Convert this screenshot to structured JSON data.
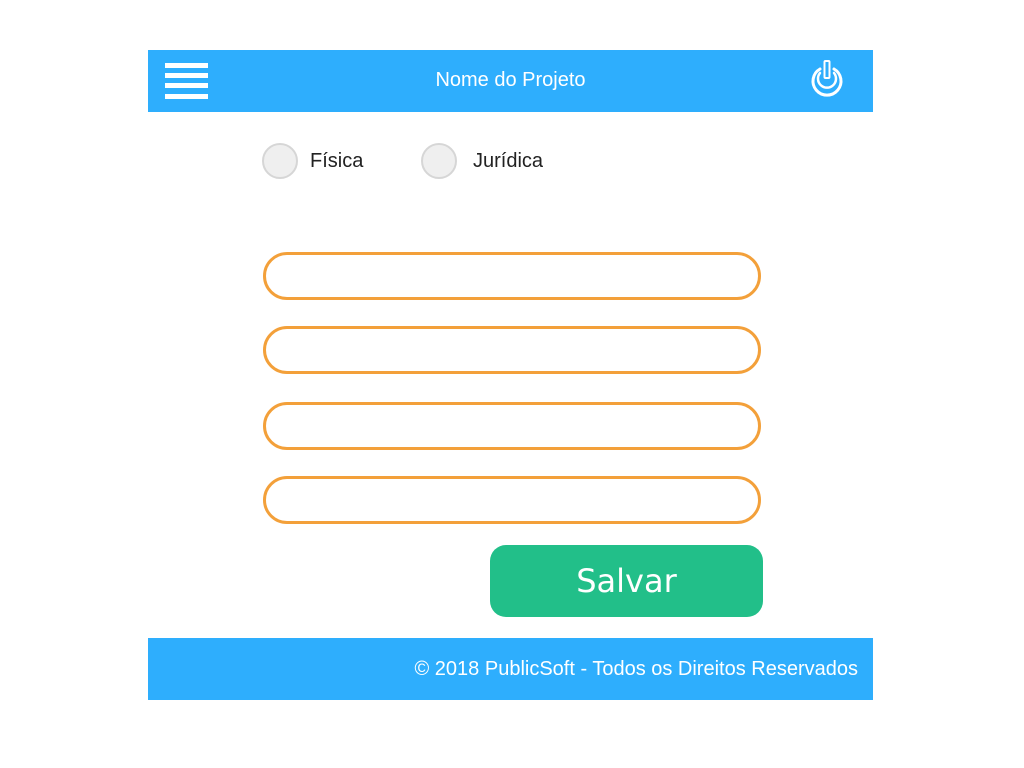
{
  "header": {
    "title": "Nome do Projeto",
    "menu_icon": "hamburger-menu-icon",
    "power_icon": "power-icon"
  },
  "person_type": {
    "options": [
      {
        "label": "Física",
        "selected": false
      },
      {
        "label": "Jurídica",
        "selected": false
      }
    ]
  },
  "form": {
    "fields": [
      {
        "value": "",
        "placeholder": ""
      },
      {
        "value": "",
        "placeholder": ""
      },
      {
        "value": "",
        "placeholder": ""
      },
      {
        "value": "",
        "placeholder": ""
      }
    ],
    "save_label": "Salvar"
  },
  "footer": {
    "text": "© 2018 PublicSoft - Todos os Direitos Reservados"
  },
  "colors": {
    "header_bg": "#2eaefd",
    "footer_bg": "#2eaefd",
    "input_border": "#f3a03a",
    "save_button_bg": "#22bf89",
    "radio_bg": "#efefef",
    "radio_border": "#d6d6d6"
  }
}
